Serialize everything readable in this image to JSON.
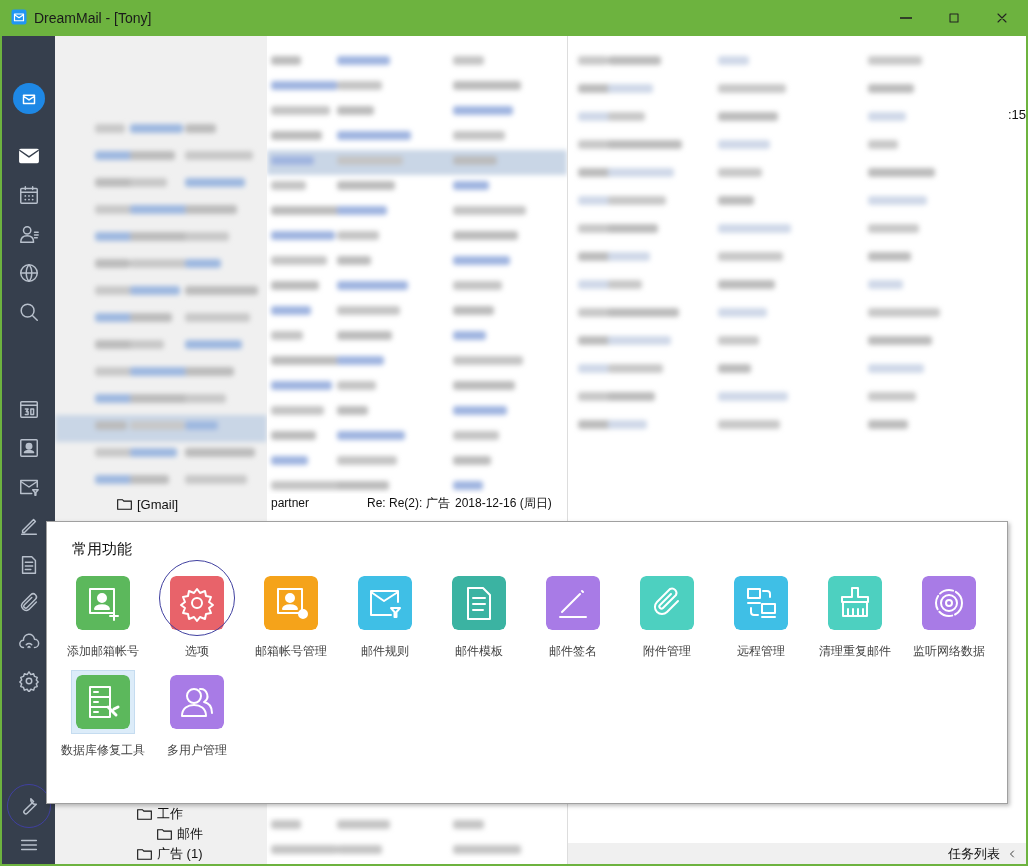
{
  "window": {
    "title": "DreamMail - [Tony]"
  },
  "rail": {
    "items": [
      {
        "selected": true,
        "circled": false
      },
      {
        "selected": false,
        "circled": false
      },
      {
        "selected": false,
        "circled": false
      },
      {
        "selected": false,
        "circled": false
      },
      {
        "selected": false,
        "circled": false
      },
      {
        "selected": false,
        "circled": false
      },
      {
        "selected": false,
        "circled": false
      },
      {
        "selected": false,
        "circled": false
      },
      {
        "selected": false,
        "circled": false
      },
      {
        "selected": false,
        "circled": false
      },
      {
        "selected": false,
        "circled": false
      },
      {
        "selected": false,
        "circled": false
      },
      {
        "selected": false,
        "circled": false
      },
      {
        "selected": false,
        "circled": true
      },
      {
        "selected": false,
        "circled": false
      }
    ]
  },
  "folders": [
    {
      "label": "[Gmail]",
      "children": [
        {
          "label": "工作",
          "children": [
            {
              "label": "邮件"
            }
          ]
        },
        {
          "label": "广告 (1)"
        }
      ]
    }
  ],
  "message_row": {
    "sender": "partner",
    "subject": "Re: Re(2): 广告",
    "date": "2018-12-16 (周日)"
  },
  "reader": {
    "time_fragment": ":15"
  },
  "status_bar": {
    "label": "任务列表"
  },
  "popup": {
    "title": "常用功能",
    "items": [
      {
        "label": "添加邮箱帐号",
        "color": "#5cb85c",
        "selected": false,
        "circled": false
      },
      {
        "label": "选项",
        "color": "#e8636a",
        "selected": false,
        "circled": true
      },
      {
        "label": "邮箱帐号管理",
        "color": "#f5a31a",
        "selected": false,
        "circled": false
      },
      {
        "label": "邮件规则",
        "color": "#3fbfe6",
        "selected": false,
        "circled": false
      },
      {
        "label": "邮件模板",
        "color": "#3bb3a2",
        "selected": false,
        "circled": false
      },
      {
        "label": "邮件签名",
        "color": "#a87be6",
        "selected": false,
        "circled": false
      },
      {
        "label": "附件管理",
        "color": "#4dd0c0",
        "selected": false,
        "circled": false
      },
      {
        "label": "远程管理",
        "color": "#3fbfe6",
        "selected": false,
        "circled": false
      },
      {
        "label": "清理重复邮件",
        "color": "#4dd0c0",
        "selected": false,
        "circled": false
      },
      {
        "label": "监听网络数据",
        "color": "#a87be6",
        "selected": false,
        "circled": false
      },
      {
        "label": "数据库修复工具",
        "color": "#5cb85c",
        "selected": true,
        "circled": false
      },
      {
        "label": "多用户管理",
        "color": "#a87be6",
        "selected": false,
        "circled": false
      }
    ]
  }
}
